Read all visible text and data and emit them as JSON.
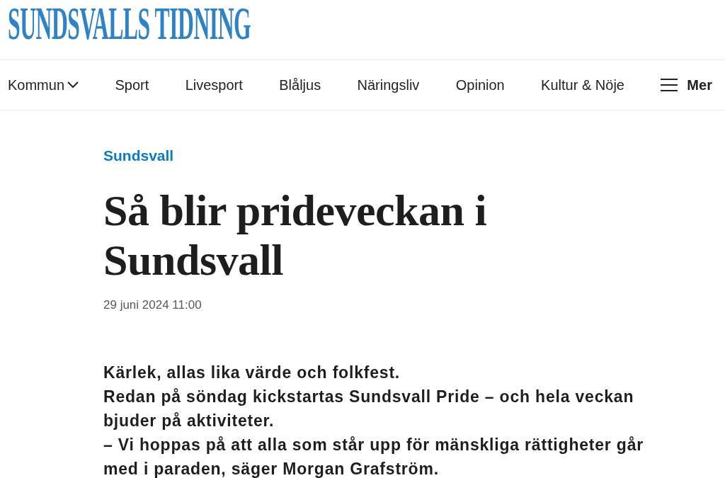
{
  "masthead": {
    "logo": "SUNDSVALLS TIDNING"
  },
  "nav": {
    "items": [
      {
        "label": "Kommun",
        "kind": "dropdown"
      },
      {
        "label": "Sport",
        "kind": "link"
      },
      {
        "label": "Livesport",
        "kind": "link"
      },
      {
        "label": "Blåljus",
        "kind": "link"
      },
      {
        "label": "Näringsliv",
        "kind": "link"
      },
      {
        "label": "Opinion",
        "kind": "link"
      },
      {
        "label": "Kultur & Nöje",
        "kind": "link"
      }
    ],
    "menu_button": {
      "label": "Mer"
    }
  },
  "article": {
    "section": "Sundsvall",
    "headline": "Så blir prideveckan i Sundsvall",
    "published": "29 juni 2024 11:00",
    "lead": [
      "Kärlek, allas lika värde och folkfest.",
      "Redan på söndag kickstartas Sundsvall Pride – och hela veckan bjuder på aktiviteter.",
      "– Vi hoppas på att alla som står upp för mänskliga rättigheter går med i paraden, säger Morgan Grafström."
    ]
  }
}
